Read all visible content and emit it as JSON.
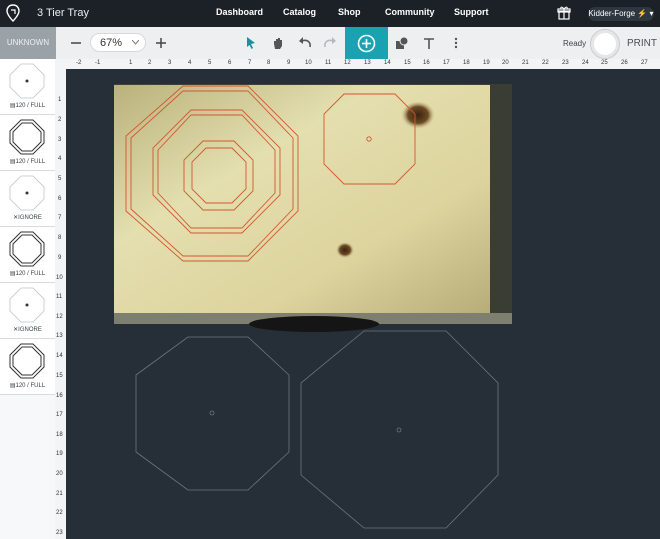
{
  "header": {
    "title": "3 Tier Tray",
    "nav": [
      "Dashboard",
      "Catalog",
      "Shop",
      "Community",
      "Support"
    ],
    "user": "Kidder-Forge"
  },
  "toolbar": {
    "mode_label": "UNKNOWN",
    "zoom": "67%",
    "status": "Ready",
    "print_label": "PRINT"
  },
  "sidebar": {
    "items": [
      {
        "label": "120 / FULL",
        "shape": "dot",
        "setting_icon": "power-setting-icon"
      },
      {
        "label": "120 / FULL",
        "shape": "octagon",
        "setting_icon": "power-setting-icon"
      },
      {
        "label": "IGNORE",
        "shape": "dot",
        "setting_icon": "ignore-icon"
      },
      {
        "label": "120 / FULL",
        "shape": "octagon",
        "setting_icon": "power-setting-icon"
      },
      {
        "label": "IGNORE",
        "shape": "dot",
        "setting_icon": "ignore-icon"
      },
      {
        "label": "120 / FULL",
        "shape": "octagon",
        "setting_icon": "power-setting-icon"
      }
    ]
  },
  "rulers": {
    "top": [
      "-2",
      "-1",
      "1",
      "2",
      "3",
      "4",
      "5",
      "6",
      "7",
      "8",
      "9",
      "10",
      "11",
      "12",
      "13",
      "14",
      "15",
      "16",
      "17",
      "18",
      "19",
      "20",
      "21",
      "22",
      "23",
      "24",
      "25",
      "26",
      "27"
    ],
    "left": [
      "1",
      "2",
      "3",
      "4",
      "5",
      "6",
      "7",
      "8",
      "9",
      "10",
      "11",
      "12",
      "13",
      "14",
      "15",
      "16",
      "17",
      "18",
      "19",
      "20",
      "21",
      "22",
      "23"
    ]
  },
  "colors": {
    "accent": "#1aa2b3",
    "cut_line": "#d2572e",
    "ghost_line": "#6d767f"
  }
}
